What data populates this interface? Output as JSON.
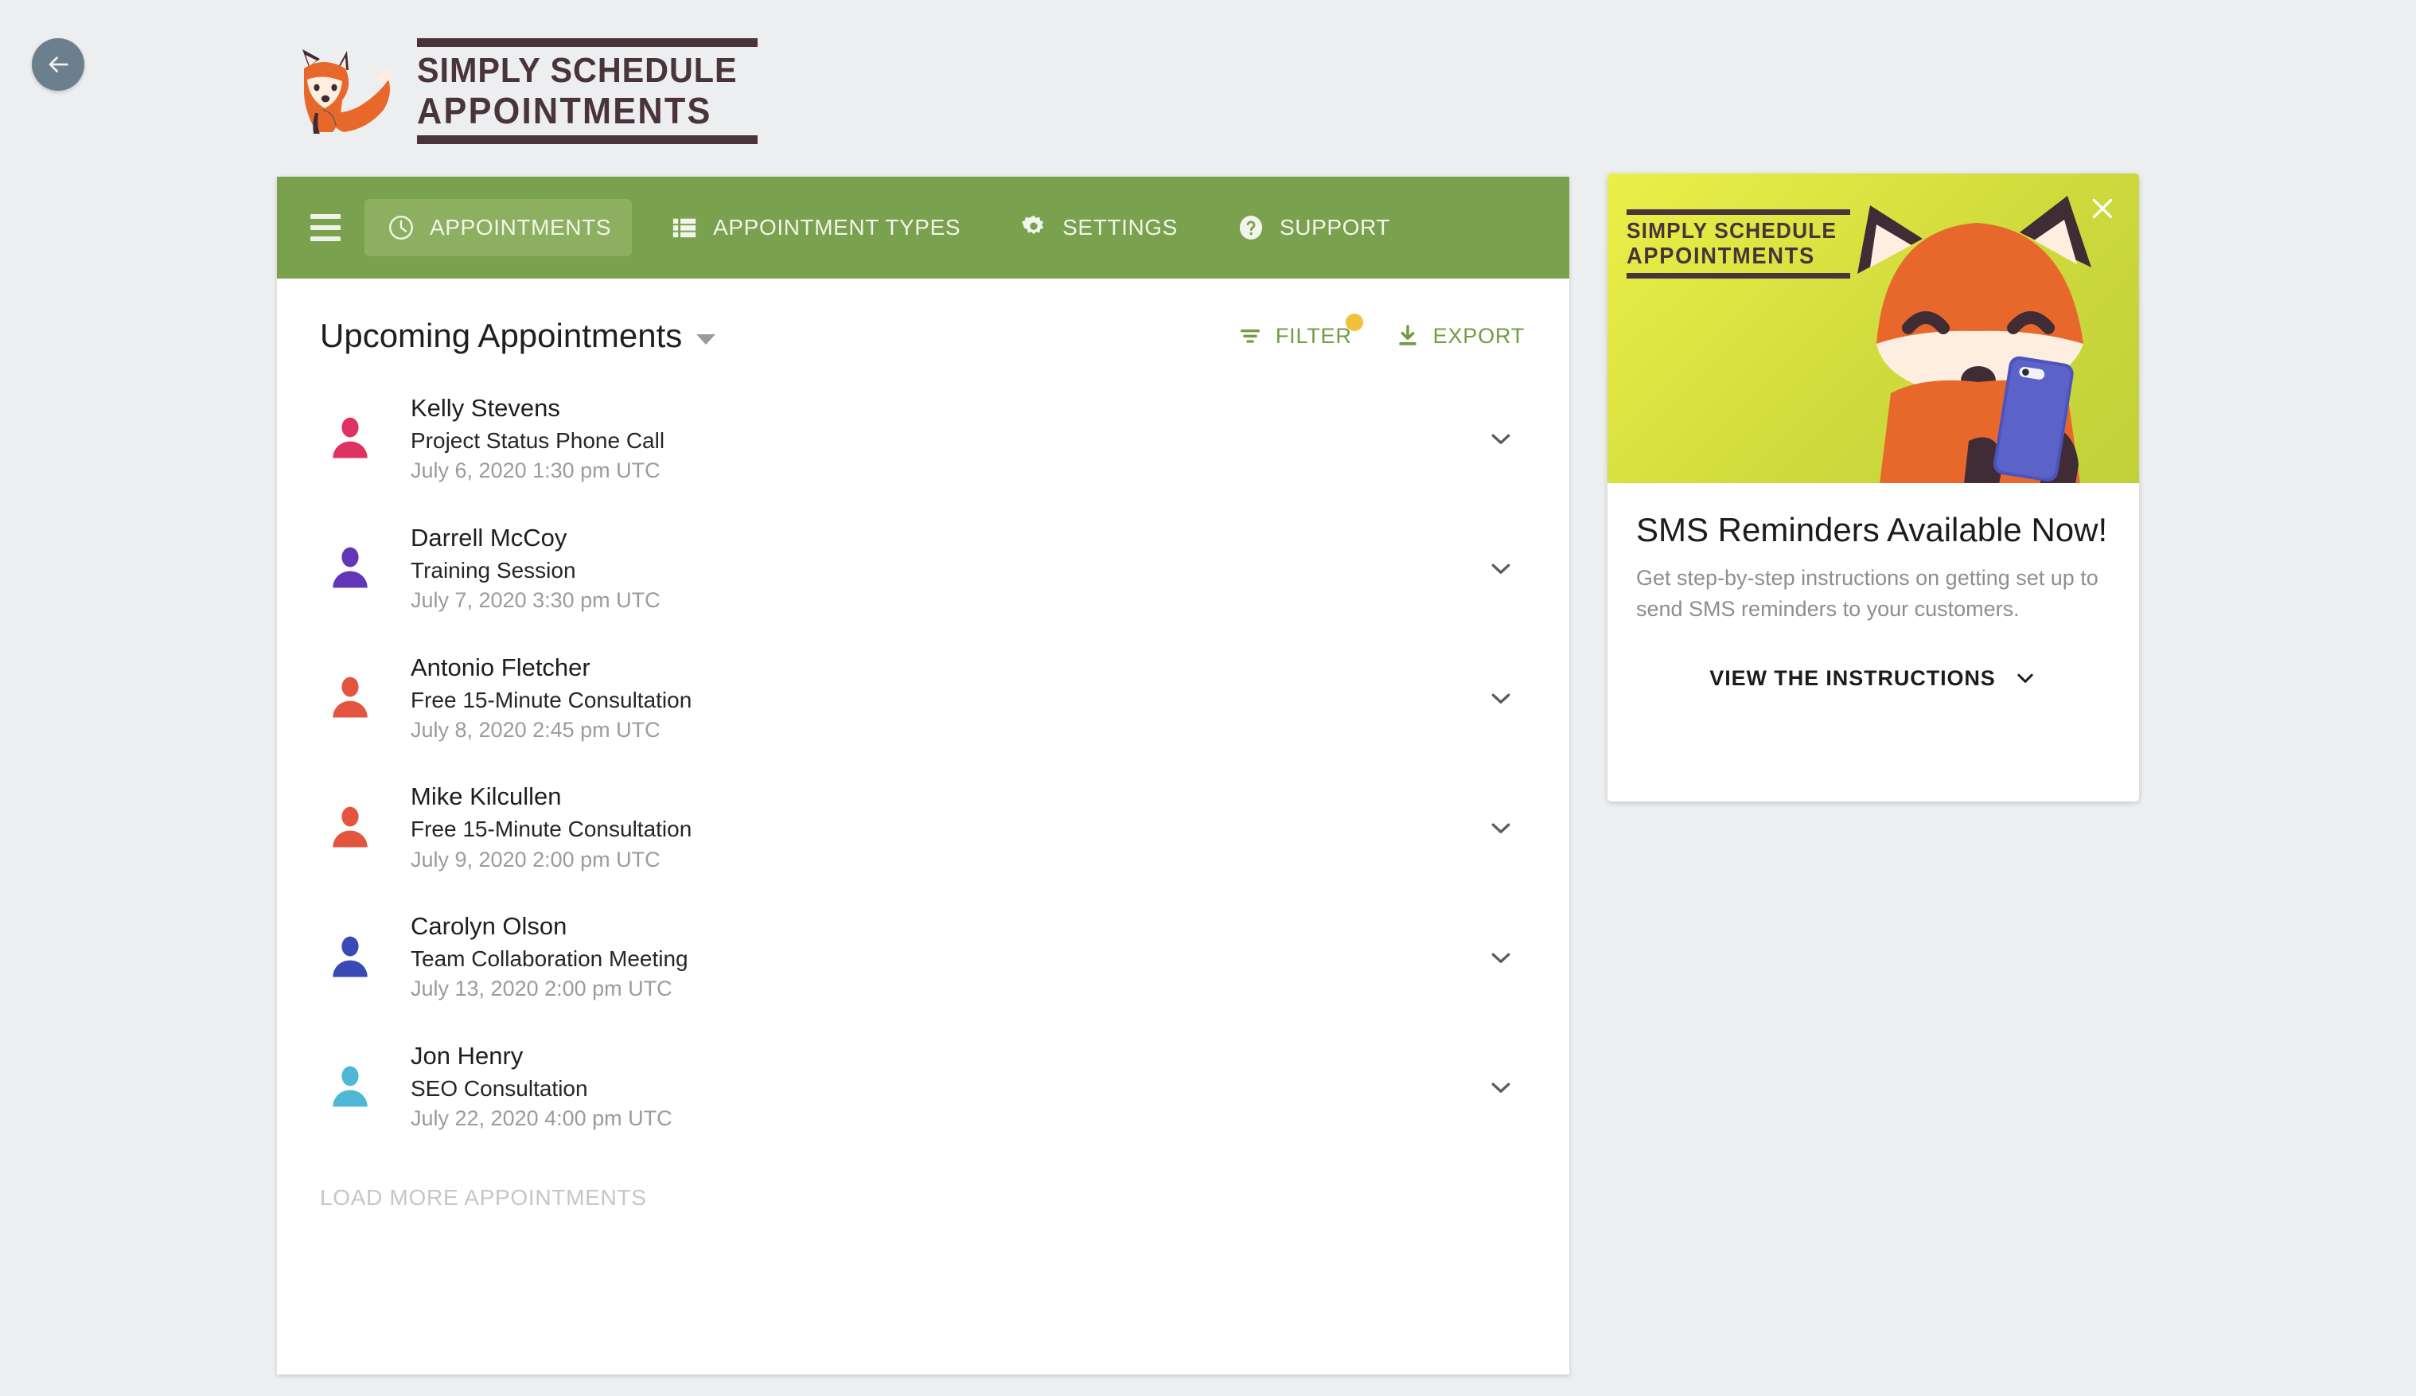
{
  "back_button": {
    "icon": "arrow-left-icon",
    "color": "#6c7f8c"
  },
  "logo": {
    "line1": "SIMPLY SCHEDULE",
    "line2": "APPOINTMENTS",
    "color": "#4a343c",
    "fox_colors": {
      "fur": "#e8682c",
      "dark": "#3f2c34",
      "cream": "#fdeee0"
    }
  },
  "nav": {
    "background": "#7aa14d",
    "active_background": "#8cb05f",
    "menu_icon": "hamburger-menu-icon",
    "items": [
      {
        "label": "APPOINTMENTS",
        "icon": "clock-icon",
        "active": true
      },
      {
        "label": "APPOINTMENT TYPES",
        "icon": "list-grid-icon",
        "active": false
      },
      {
        "label": "SETTINGS",
        "icon": "gear-icon",
        "active": false
      },
      {
        "label": "SUPPORT",
        "icon": "help-circle-icon",
        "active": false
      }
    ]
  },
  "toolbar": {
    "list_title": "Upcoming Appointments",
    "title_caret_icon": "caret-down-icon",
    "filter_label": "FILTER",
    "filter_icon": "filter-icon",
    "filter_badge": true,
    "filter_badge_color": "#f2c13c",
    "export_label": "EXPORT",
    "export_icon": "download-icon",
    "accent_color": "#6f9d3f"
  },
  "appointments": [
    {
      "name": "Kelly Stevens",
      "type": "Project Status Phone Call",
      "time": "July 6, 2020 1:30 pm UTC",
      "avatar_color": "#e03262",
      "avatar_icon": "person-avatar-icon",
      "expand_icon": "chevron-down-icon"
    },
    {
      "name": "Darrell McCoy",
      "type": "Training Session",
      "time": "July 7, 2020 3:30 pm UTC",
      "avatar_color": "#6137b8",
      "avatar_icon": "person-avatar-icon",
      "expand_icon": "chevron-down-icon"
    },
    {
      "name": "Antonio Fletcher",
      "type": "Free 15-Minute Consultation",
      "time": "July 8, 2020 2:45 pm UTC",
      "avatar_color": "#e3553f",
      "avatar_icon": "person-avatar-icon",
      "expand_icon": "chevron-down-icon"
    },
    {
      "name": "Mike Kilcullen",
      "type": "Free 15-Minute Consultation",
      "time": "July 9, 2020 2:00 pm UTC",
      "avatar_color": "#e3553f",
      "avatar_icon": "person-avatar-icon",
      "expand_icon": "chevron-down-icon"
    },
    {
      "name": "Carolyn Olson",
      "type": "Team Collaboration Meeting",
      "time": "July 13, 2020 2:00 pm UTC",
      "avatar_color": "#3949b5",
      "avatar_icon": "person-avatar-icon",
      "expand_icon": "chevron-down-icon"
    },
    {
      "name": "Jon Henry",
      "type": "SEO Consultation",
      "time": "July 22, 2020 4:00 pm UTC",
      "avatar_color": "#4fb8d6",
      "avatar_icon": "person-avatar-icon",
      "expand_icon": "chevron-down-icon"
    }
  ],
  "load_more_label": "LOAD MORE APPOINTMENTS",
  "promo": {
    "logo_line1": "SIMPLY SCHEDULE",
    "logo_line2": "APPOINTMENTS",
    "close_icon": "close-icon",
    "illustration": "fox-with-phone-illustration",
    "title": "SMS Reminders Available Now!",
    "description": "Get step-by-step instructions on getting set up to send SMS reminders to your customers.",
    "cta_label": "VIEW THE INSTRUCTIONS",
    "cta_icon": "chevron-down-icon",
    "hero_gradient_from": "#eaf048",
    "hero_gradient_to": "#c2d139"
  }
}
